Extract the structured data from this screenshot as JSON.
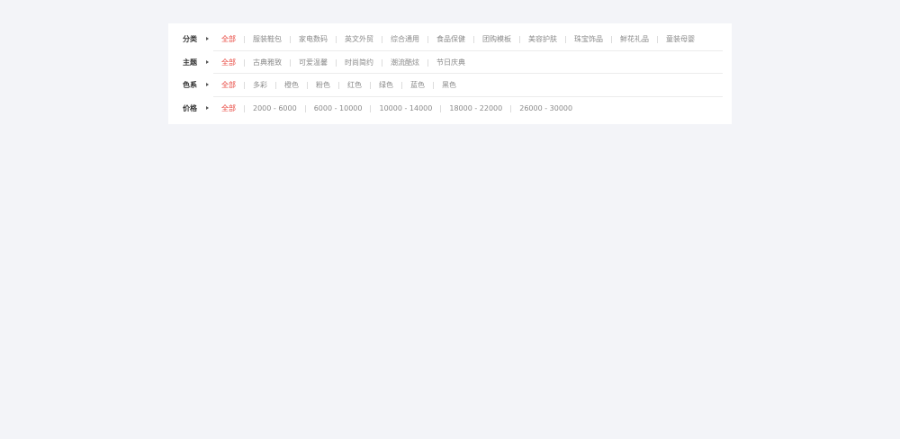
{
  "filters": [
    {
      "label": "分类",
      "options": [
        "全部",
        "服装鞋包",
        "家电数码",
        "英文外贸",
        "综合通用",
        "食品保健",
        "团购模板",
        "美容护肤",
        "珠宝饰品",
        "鲜花礼品",
        "童装母婴"
      ],
      "active_index": 0
    },
    {
      "label": "主题",
      "options": [
        "全部",
        "古典雅致",
        "可爱温馨",
        "时尚简约",
        "潮流酷炫",
        "节日庆典"
      ],
      "active_index": 0
    },
    {
      "label": "色系",
      "options": [
        "全部",
        "多彩",
        "橙色",
        "粉色",
        "红色",
        "绿色",
        "蓝色",
        "黑色"
      ],
      "active_index": 0
    },
    {
      "label": "价格",
      "options": [
        "全部",
        "2000 - 6000",
        "6000 - 10000",
        "10000 - 14000",
        "18000 - 22000",
        "26000 - 30000"
      ],
      "active_index": 0
    }
  ],
  "colors": {
    "active": "#e8473f",
    "option": "#8a8a8a",
    "label": "#333333",
    "background": "#f3f4f8",
    "panel": "#ffffff"
  },
  "icons": {
    "row_arrow": "caret-right-icon"
  }
}
